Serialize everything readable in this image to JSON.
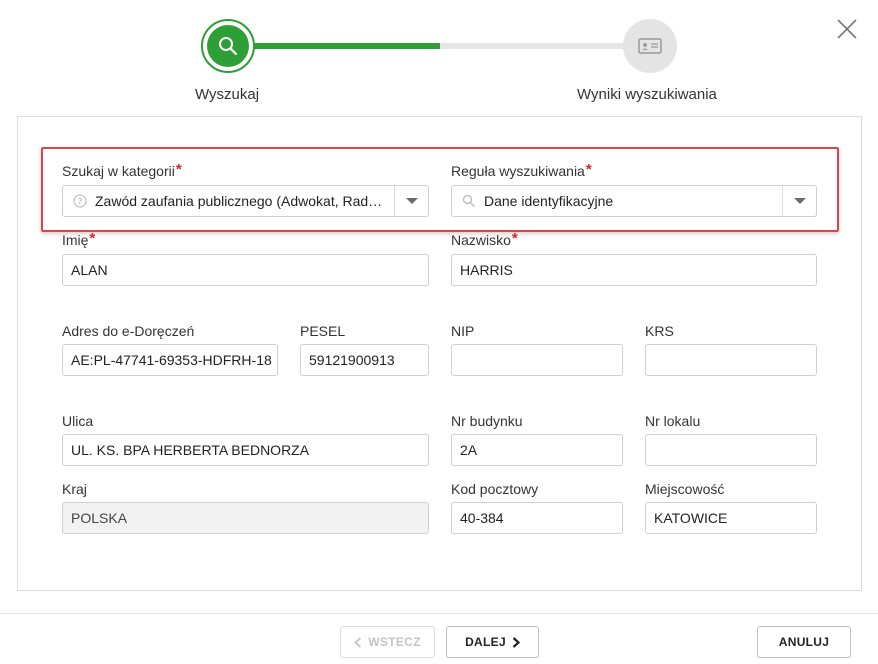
{
  "stepper": {
    "steps": [
      {
        "label": "Wyszukaj",
        "state": "active"
      },
      {
        "label": "Wyniki wyszukiwania",
        "state": "inactive"
      }
    ],
    "progress": 0.5
  },
  "form": {
    "category": {
      "label": "Szukaj w kategorii",
      "required_mark": "*",
      "value": "Zawód zaufania publicznego (Adwokat, Radca prawny, Notariusz, Komornik)"
    },
    "rule": {
      "label": "Reguła wyszukiwania",
      "required_mark": "*",
      "value": "Dane identyfikacyjne"
    },
    "first_name": {
      "label": "Imię",
      "required_mark": "*",
      "value": "ALAN"
    },
    "last_name": {
      "label": "Nazwisko",
      "required_mark": "*",
      "value": "HARRIS"
    },
    "edelivery": {
      "label": "Adres do e-Doręczeń",
      "value": "AE:PL-47741-69353-HDFRH-18"
    },
    "pesel": {
      "label": "PESEL",
      "value": "59121900913"
    },
    "nip": {
      "label": "NIP",
      "value": ""
    },
    "krs": {
      "label": "KRS",
      "value": ""
    },
    "street": {
      "label": "Ulica",
      "value": "UL. KS. BPA HERBERTA BEDNORZA"
    },
    "building": {
      "label": "Nr budynku",
      "value": "2A"
    },
    "apartment": {
      "label": "Nr lokalu",
      "value": ""
    },
    "country": {
      "label": "Kraj",
      "value": "POLSKA"
    },
    "postal": {
      "label": "Kod pocztowy",
      "value": "40-384"
    },
    "city": {
      "label": "Miejscowość",
      "value": "KATOWICE"
    }
  },
  "footer": {
    "back_label": "WSTECZ",
    "next_label": "DALEJ",
    "cancel_label": "ANULUJ"
  },
  "icons": {
    "close": "close-icon",
    "step1": "search-icon",
    "step2": "id-card-icon",
    "category": "help-circle-icon",
    "rule": "search-icon"
  },
  "colors": {
    "accent": "#2e9e36",
    "highlight": "#e0424a",
    "required": "#e0202a"
  }
}
